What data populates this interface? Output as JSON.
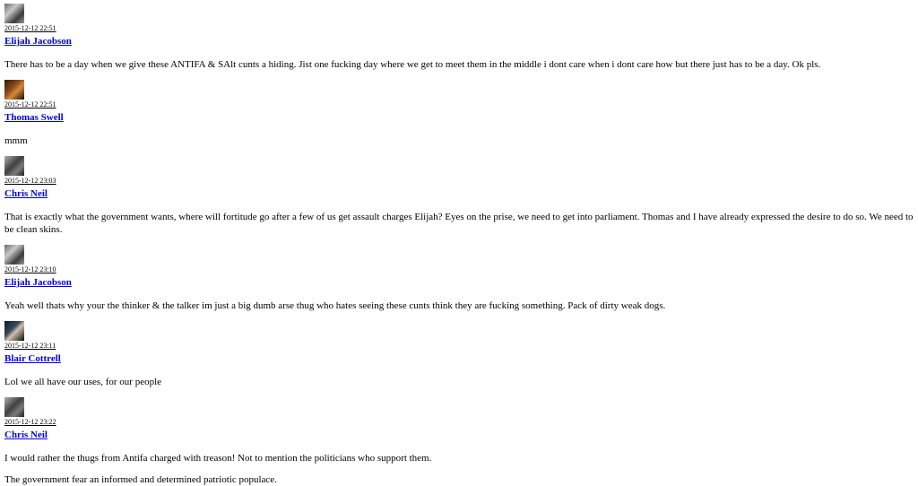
{
  "posts": [
    {
      "avatar_icon": "user-avatar-icon",
      "timestamp": "2015-12-12 22:51",
      "author": "Elijah Jacobson",
      "messages": [
        "There has to be a day when we give these ANTIFA & SAlt cunts a hiding. Jist one fucking day where we get to meet them in the middle i dont care when i dont care how but there just has to be a day. Ok pls."
      ]
    },
    {
      "avatar_icon": "user-avatar-icon",
      "timestamp": "2015-12-12 22:51",
      "author": "Thomas Swell",
      "messages": [
        "mmm"
      ]
    },
    {
      "avatar_icon": "user-avatar-icon",
      "timestamp": "2015-12-12 23:03",
      "author": "Chris Neil",
      "messages": [
        "That is exactly what the government wants, where will fortitude go after a few of us get assault charges Elijah? Eyes on the prise, we need to get into parliament. Thomas and I have already expressed the desire to do so. We need to be clean skins."
      ]
    },
    {
      "avatar_icon": "user-avatar-icon",
      "timestamp": "2015-12-12 23:10",
      "author": "Elijah Jacobson",
      "messages": [
        "Yeah well thats why your the thinker & the talker im just a big dumb arse thug who hates seeing these cunts think they are fucking something. Pack of dirty weak dogs."
      ]
    },
    {
      "avatar_icon": "user-avatar-icon",
      "timestamp": "2015-12-12 23:11",
      "author": "Blair Cottrell",
      "messages": [
        "Lol we all have our uses, for our people"
      ]
    },
    {
      "avatar_icon": "user-avatar-icon",
      "timestamp": "2015-12-12 23:22",
      "author": "Chris Neil",
      "messages": [
        "I would rather the thugs from Antifa charged with treason! Not to mention the politicians who support them.",
        "The government fear an informed and determined patriotic populace."
      ]
    }
  ]
}
